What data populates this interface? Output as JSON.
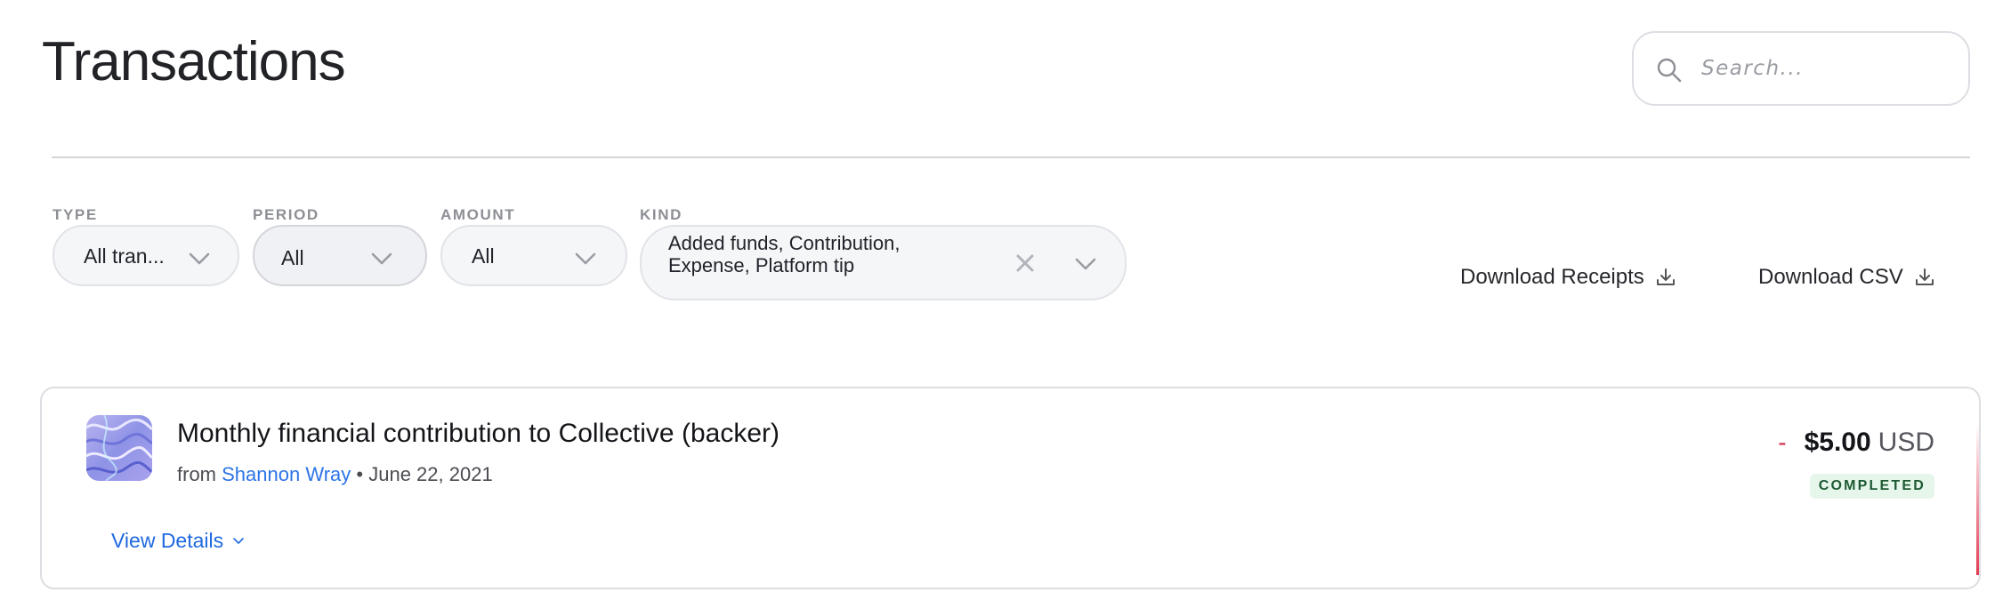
{
  "page": {
    "title": "Transactions"
  },
  "search": {
    "placeholder": "Search...",
    "value": ""
  },
  "filters": {
    "type": {
      "label": "TYPE",
      "value": "All tran..."
    },
    "period": {
      "label": "PERIOD",
      "value": "All"
    },
    "amount": {
      "label": "AMOUNT",
      "value": "All"
    },
    "kind": {
      "label": "KIND",
      "value": "Added funds, Contribution, Expense, Platform tip"
    }
  },
  "downloads": {
    "receipts_label": "Download Receipts",
    "csv_label": "Download CSV"
  },
  "transactions": [
    {
      "title": "Monthly financial contribution to Collective (backer)",
      "from_prefix": "from",
      "from_name": "Shannon Wray",
      "separator": "•",
      "date": "June 22, 2021",
      "amount_sign": "-",
      "amount_value": "$5.00",
      "currency": "USD",
      "status": "COMPLETED",
      "view_details_label": "View Details"
    }
  ],
  "colors": {
    "accent_link": "#2c74e6",
    "negative": "#d12a4a",
    "status_bg": "#e6f6ea",
    "status_text": "#1e5a33"
  },
  "icons": [
    "search-icon",
    "chevron-down-icon",
    "clear-icon",
    "download-icon",
    "avatar-image"
  ]
}
